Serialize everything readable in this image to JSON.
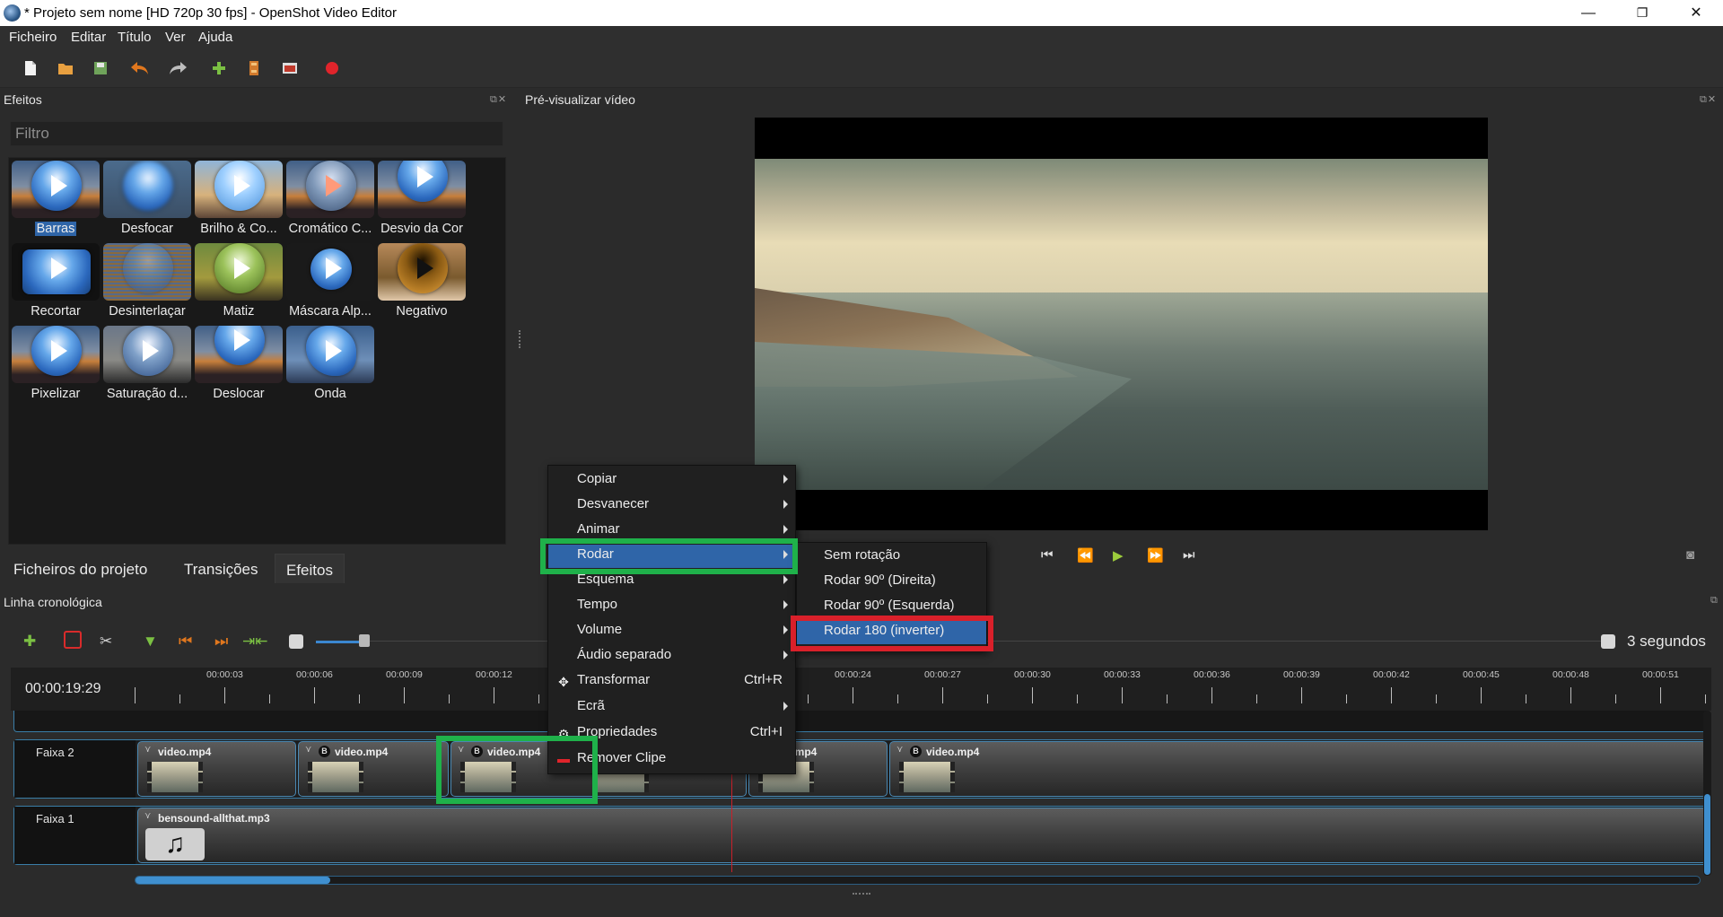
{
  "window": {
    "title": "* Projeto sem nome [HD 720p 30 fps] - OpenShot Video Editor",
    "min": "—",
    "max": "❐",
    "close": "✕"
  },
  "menubar": [
    "Ficheiro",
    "Editar",
    "Título",
    "Ver",
    "Ajuda"
  ],
  "effects_panel": {
    "title": "Efeitos",
    "filter_placeholder": "Filtro",
    "effects": [
      "Barras",
      "Desfocar",
      "Brilho & Co...",
      "Cromático C...",
      "Desvio da Cor",
      "Recortar",
      "Desinterlaçar",
      "Matiz",
      "Máscara Alp...",
      "Negativo",
      "Pixelizar",
      "Saturação d...",
      "Deslocar",
      "Onda"
    ],
    "selected": "Barras"
  },
  "tabs": [
    "Ficheiros do projeto",
    "Transições",
    "Efeitos"
  ],
  "preview": {
    "title": "Pré-visualizar vídeo"
  },
  "timeline": {
    "title": "Linha cronológica",
    "current_time": "00:00:19:29",
    "zoom_label": "3 segundos",
    "ticks": [
      "00:00:03",
      "00:00:06",
      "00:00:09",
      "00:00:12",
      "00:00:24",
      "00:00:27",
      "00:00:30",
      "00:00:33",
      "00:00:36",
      "00:00:39",
      "00:00:42",
      "00:00:45",
      "00:00:48",
      "00:00:51"
    ],
    "tracks": [
      {
        "name": "Faixa 2",
        "clips": [
          "video.mp4",
          "video.mp4",
          "video.mp4",
          "o.mp4",
          "video.mp4"
        ]
      },
      {
        "name": "Faixa 1",
        "clips": [
          "bensound-allthat.mp3"
        ]
      }
    ],
    "clip_badge": "B"
  },
  "context_menu": {
    "items": [
      {
        "label": "Copiar",
        "submenu": true
      },
      {
        "label": "Desvanecer",
        "submenu": true
      },
      {
        "label": "Animar",
        "submenu": true
      },
      {
        "label": "Rodar",
        "submenu": true
      },
      {
        "label": "Esquema",
        "submenu": true
      },
      {
        "label": "Tempo",
        "submenu": true
      },
      {
        "label": "Volume",
        "submenu": true
      },
      {
        "label": "Áudio separado",
        "submenu": true
      },
      {
        "label": "Transformar",
        "shortcut": "Ctrl+R"
      },
      {
        "label": "Ecrã",
        "submenu": true
      },
      {
        "label": "Propriedades",
        "shortcut": "Ctrl+I"
      },
      {
        "label": "Remover Clipe"
      }
    ],
    "highlighted": "Rodar"
  },
  "rotate_submenu": {
    "items": [
      "Sem rotação",
      "Rodar 90º (Direita)",
      "Rodar 90º (Esquerda)",
      "Rodar 180 (inverter)"
    ],
    "highlighted": "Rodar 180 (inverter)"
  },
  "colors": {
    "highlight": "#2f65a8",
    "annotation_green": "#1fb14a",
    "annotation_red": "#d9202a",
    "playhead": "#c8202a"
  }
}
